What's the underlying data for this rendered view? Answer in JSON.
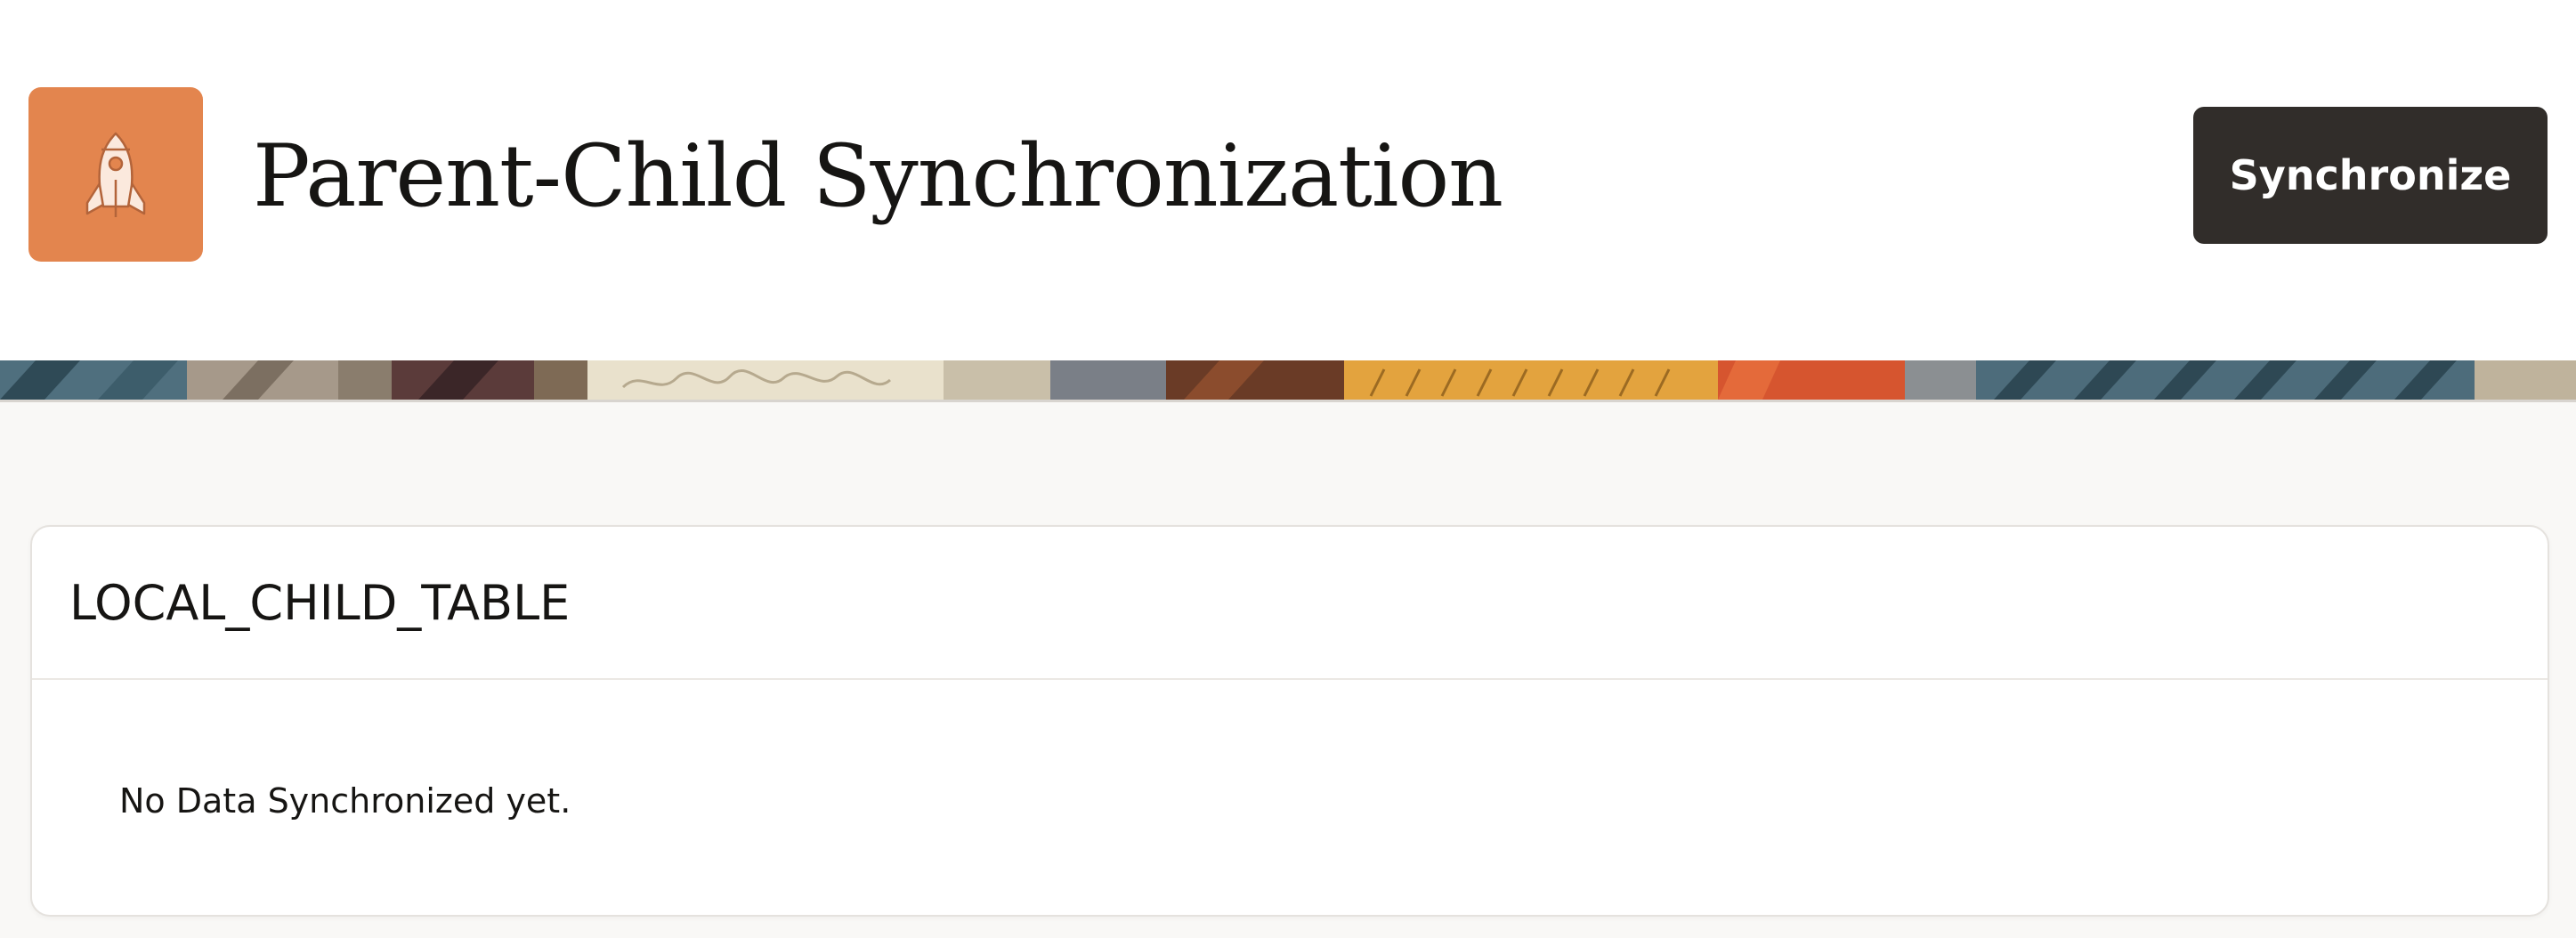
{
  "header": {
    "app_icon": "rocket-icon",
    "title": "Parent-Child Synchronization",
    "synchronize_label": "Synchronize"
  },
  "region": {
    "title": "LOCAL_CHILD_TABLE",
    "empty_message": "No Data Synchronized yet."
  },
  "colors": {
    "icon_background": "#e3854e",
    "button_background": "#312d2a",
    "page_background": "#f9f8f6"
  }
}
